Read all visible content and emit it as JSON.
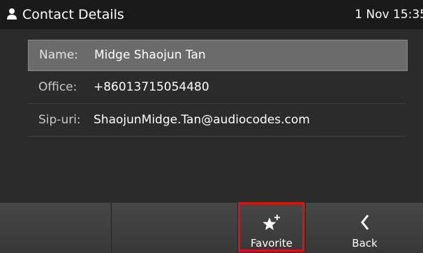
{
  "header": {
    "title": "Contact Details",
    "clock": "1 Nov 15:35",
    "icon": "person-icon"
  },
  "details": [
    {
      "label": "Name:",
      "value": "Midge Shaojun  Tan",
      "selected": true
    },
    {
      "label": "Office:",
      "value": "+86013715054480",
      "selected": false
    },
    {
      "label": "Sip-uri:",
      "value": "ShaojunMidge.Tan@audiocodes.com",
      "selected": false
    }
  ],
  "softkeys": [
    {
      "label": "",
      "icon": ""
    },
    {
      "label": "",
      "icon": ""
    },
    {
      "label": "Favorite",
      "icon": "star-plus-icon"
    },
    {
      "label": "Back",
      "icon": "chevron-left-icon"
    }
  ],
  "colors": {
    "header_bg": "#1a1a1a",
    "content_bg": "#2b2b2b",
    "selected_row_bg": "#6b6b6b",
    "softkey_bg": "#3c3c3c",
    "highlight_border": "#e01010"
  }
}
